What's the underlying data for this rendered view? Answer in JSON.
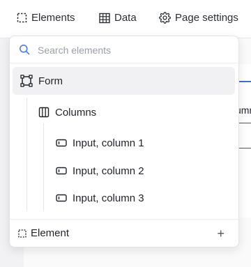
{
  "topbar": {
    "tabs": [
      {
        "label": "Elements",
        "icon": "dashed-square-icon"
      },
      {
        "label": "Data",
        "icon": "table-grid-icon"
      },
      {
        "label": "Page settings",
        "icon": "gear-icon"
      }
    ]
  },
  "background": {
    "partial_text": "umn"
  },
  "dropdown": {
    "search": {
      "placeholder": "Search elements",
      "value": ""
    },
    "tree": [
      {
        "label": "Form",
        "icon": "form-frame-icon",
        "selected": true
      },
      {
        "label": "Columns",
        "icon": "columns-icon"
      },
      {
        "label": "Input, column 1",
        "icon": "input-icon"
      },
      {
        "label": "Input, column 2",
        "icon": "input-icon"
      },
      {
        "label": "Input, column 3",
        "icon": "input-icon"
      }
    ],
    "footer": {
      "label": "Element",
      "icon": "dashed-square-icon",
      "action": "+"
    }
  },
  "colors": {
    "accent": "#3f6fd8",
    "search_icon": "#4a7fe0"
  }
}
